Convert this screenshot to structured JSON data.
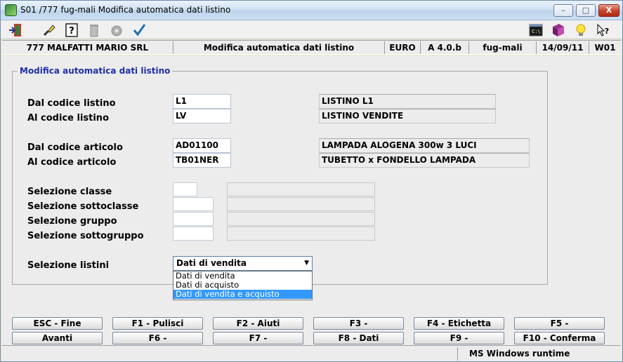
{
  "window": {
    "title": "S01 /777 fug-mali Modifica automatica dati listino",
    "minimize": "–",
    "maximize": "□",
    "close": "X"
  },
  "toolbar": {
    "icons": [
      "exit-icon",
      "brush-icon",
      "help-icon",
      "trash-icon",
      "settings-icon",
      "check-icon",
      "console-icon",
      "book-icon",
      "bulb-icon",
      "what-is-icon"
    ]
  },
  "status_top": {
    "company": "777 MALFATTI MARIO SRL",
    "function": "Modifica automatica dati listino",
    "currency": "EURO",
    "version": "A 4.0.b",
    "user": "fug-mali",
    "date": "14/09/11",
    "workstation": "W01"
  },
  "form": {
    "group_title": "Modifica automatica dati listino",
    "dal_listino_label": "Dal codice listino",
    "dal_listino_value": "L1",
    "dal_listino_desc": "LISTINO L1",
    "al_listino_label": "Al   codice listino",
    "al_listino_value": "LV",
    "al_listino_desc": "LISTINO VENDITE",
    "dal_articolo_label": "Dal codice articolo",
    "dal_articolo_value": "AD01100",
    "dal_articolo_desc": "LAMPADA ALOGENA 300w 3 LUCI",
    "al_articolo_label": "Al   codice articolo",
    "al_articolo_value": "TB01NER",
    "al_articolo_desc": "TUBETTO x FONDELLO LAMPADA",
    "classe_label": "Selezione classe",
    "sottoclasse_label": "Selezione sottoclasse",
    "gruppo_label": "Selezione gruppo",
    "sottogruppo_label": "Selezione sottogruppo",
    "listini_label": "Selezione listini",
    "listini_selected": "Dati di vendita",
    "listini_options": [
      "Dati di vendita",
      "Dati di acquisto",
      "Dati di vendita e acquisto"
    ]
  },
  "fkeys": {
    "row1": [
      "ESC - Fine",
      "F1 - Pulisci",
      "F2 -  Aiuti",
      "F3 -",
      "F4 - Etichetta",
      "F5 -"
    ],
    "row2": [
      "Avanti",
      "F6 -",
      "F7 -",
      "F8 - Dati",
      "F9 -",
      "F10 - Conferma"
    ]
  },
  "bottom": {
    "runtime": "MS Windows runtime"
  },
  "colors": {
    "group_title": "#1e2ea8",
    "selection": "#3399ff",
    "background": "#ececec"
  }
}
